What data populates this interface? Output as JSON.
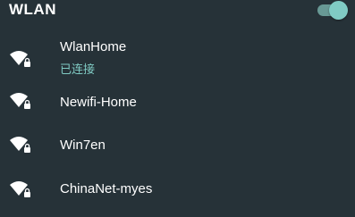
{
  "header": {
    "title": "WLAN",
    "toggle_on": true,
    "accent_color": "#80cbc4"
  },
  "networks": [
    {
      "ssid": "WlanHome",
      "status": "已连接",
      "secured": true,
      "icon": "wifi-lock-icon"
    },
    {
      "ssid": "Newifi-Home",
      "status": "",
      "secured": true,
      "icon": "wifi-lock-icon"
    },
    {
      "ssid": "Win7en",
      "status": "",
      "secured": true,
      "icon": "wifi-lock-icon"
    },
    {
      "ssid": "ChinaNet-myes",
      "status": "",
      "secured": true,
      "icon": "wifi-lock-icon"
    }
  ]
}
